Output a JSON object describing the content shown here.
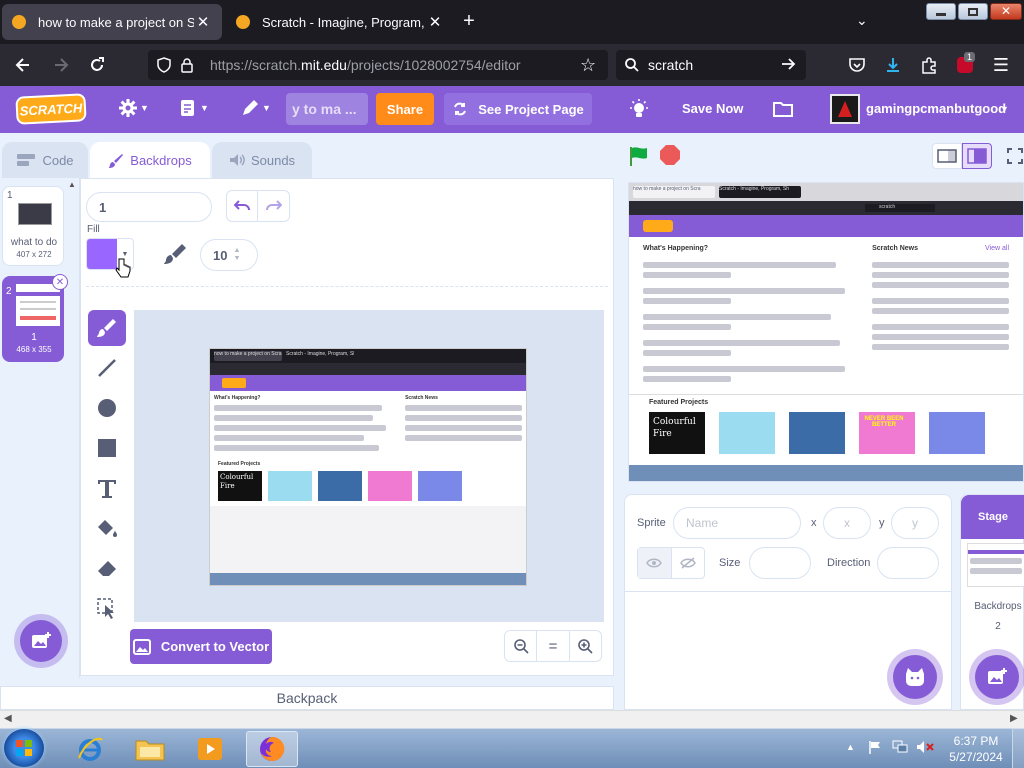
{
  "browser": {
    "tabs": [
      {
        "title": "how to make a project on Scrat",
        "active": true
      },
      {
        "title": "Scratch - Imagine, Program, Sh",
        "active": false
      }
    ],
    "url_prefix": "https://scratch.",
    "url_domain": "mit.edu",
    "url_path": "/projects/1028002754/editor",
    "search_text": "scratch",
    "notification_count": "1"
  },
  "menu": {
    "logo": "SCRATCH",
    "project_title": "y to ma ...",
    "share_label": "Share",
    "see_project_label": "See Project Page",
    "save_label": "Save Now",
    "username": "gamingpcmanbutgood"
  },
  "editor_tabs": {
    "code": "Code",
    "backdrops": "Backdrops",
    "sounds": "Sounds"
  },
  "backdrops": [
    {
      "number": "1",
      "name": "what to do",
      "size": "407 x 272",
      "selected": false
    },
    {
      "number": "2",
      "name": "1",
      "size": "468 x 355",
      "selected": true
    }
  ],
  "paint": {
    "costume_name": "1",
    "fill_label": "Fill",
    "fill_color": "#9966ff",
    "brush_size": "10",
    "convert_label": "Convert to Vector",
    "zoom_reset": "="
  },
  "backpack_label": "Backpack",
  "screenshot_inner": {
    "whats_happening": "What's Happening?",
    "scratch_news": "Scratch News",
    "view_all": "View all",
    "featured_projects": "Featured Projects",
    "colourful": "Colourful",
    "fire": "Fire",
    "tab1": "how to make a project on Scra",
    "tab2": "Scratch - Imagine, Program, Sh",
    "search": "scratch",
    "never_been": "NEVER BEEN",
    "better": "BETTER"
  },
  "sprite_info": {
    "sprite_label": "Sprite",
    "name_placeholder": "Name",
    "x_label": "x",
    "x_placeholder": "x",
    "y_label": "y",
    "y_placeholder": "y",
    "size_label": "Size",
    "direction_label": "Direction"
  },
  "stage_pane": {
    "title": "Stage",
    "backdrops_label": "Backdrops",
    "backdrops_count": "2"
  },
  "taskbar": {
    "time": "6:37 PM",
    "date": "5/27/2024"
  },
  "colors": {
    "scratch_purple": "#855cd6",
    "share_orange": "#ff8c1a",
    "fill": "#9966ff",
    "green_flag": "#0faa40",
    "stop_red": "#ec5959"
  }
}
